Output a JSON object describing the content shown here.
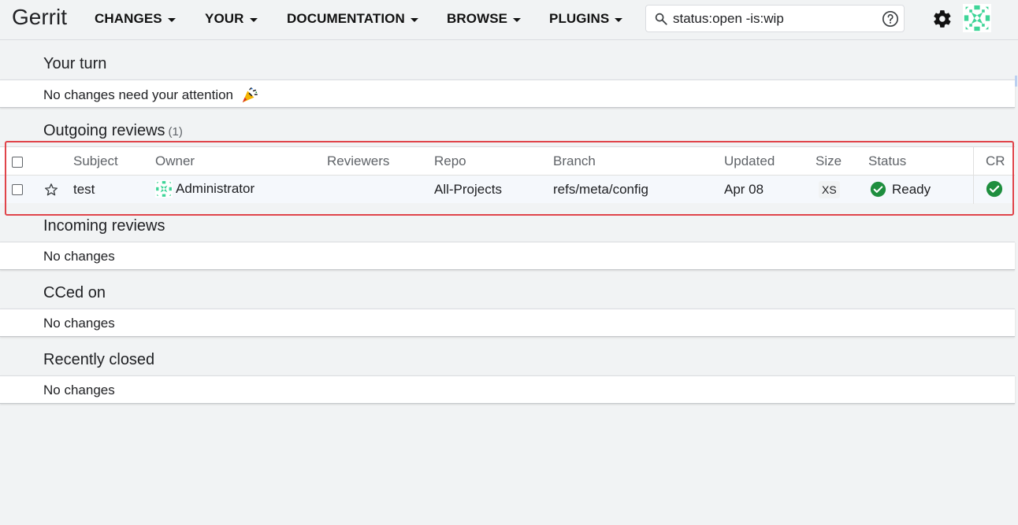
{
  "header": {
    "logo": "Gerrit",
    "nav": [
      {
        "label": "CHANGES"
      },
      {
        "label": "YOUR"
      },
      {
        "label": "DOCUMENTATION"
      },
      {
        "label": "BROWSE"
      },
      {
        "label": "PLUGINS"
      }
    ],
    "search_value": "status:open -is:wip"
  },
  "sections": {
    "your_turn": {
      "title": "Your turn",
      "message": "No changes need your attention"
    },
    "outgoing": {
      "title": "Outgoing reviews",
      "count": "(1)"
    },
    "incoming": {
      "title": "Incoming reviews",
      "message": "No changes"
    },
    "cced": {
      "title": "CCed on",
      "message": "No changes"
    },
    "closed": {
      "title": "Recently closed",
      "message": "No changes"
    }
  },
  "table": {
    "columns": [
      "Subject",
      "Owner",
      "Reviewers",
      "Repo",
      "Branch",
      "Updated",
      "Size",
      "Status",
      "CR"
    ],
    "row": {
      "subject": "test",
      "owner": "Administrator",
      "reviewers": "",
      "repo": "All-Projects",
      "branch": "refs/meta/config",
      "updated": "Apr 08",
      "size": "XS",
      "status": "Ready"
    }
  },
  "colors": {
    "accent_green": "#1e8e3e",
    "avatar_green": "#3ed598",
    "highlight_red": "#e0444a"
  }
}
